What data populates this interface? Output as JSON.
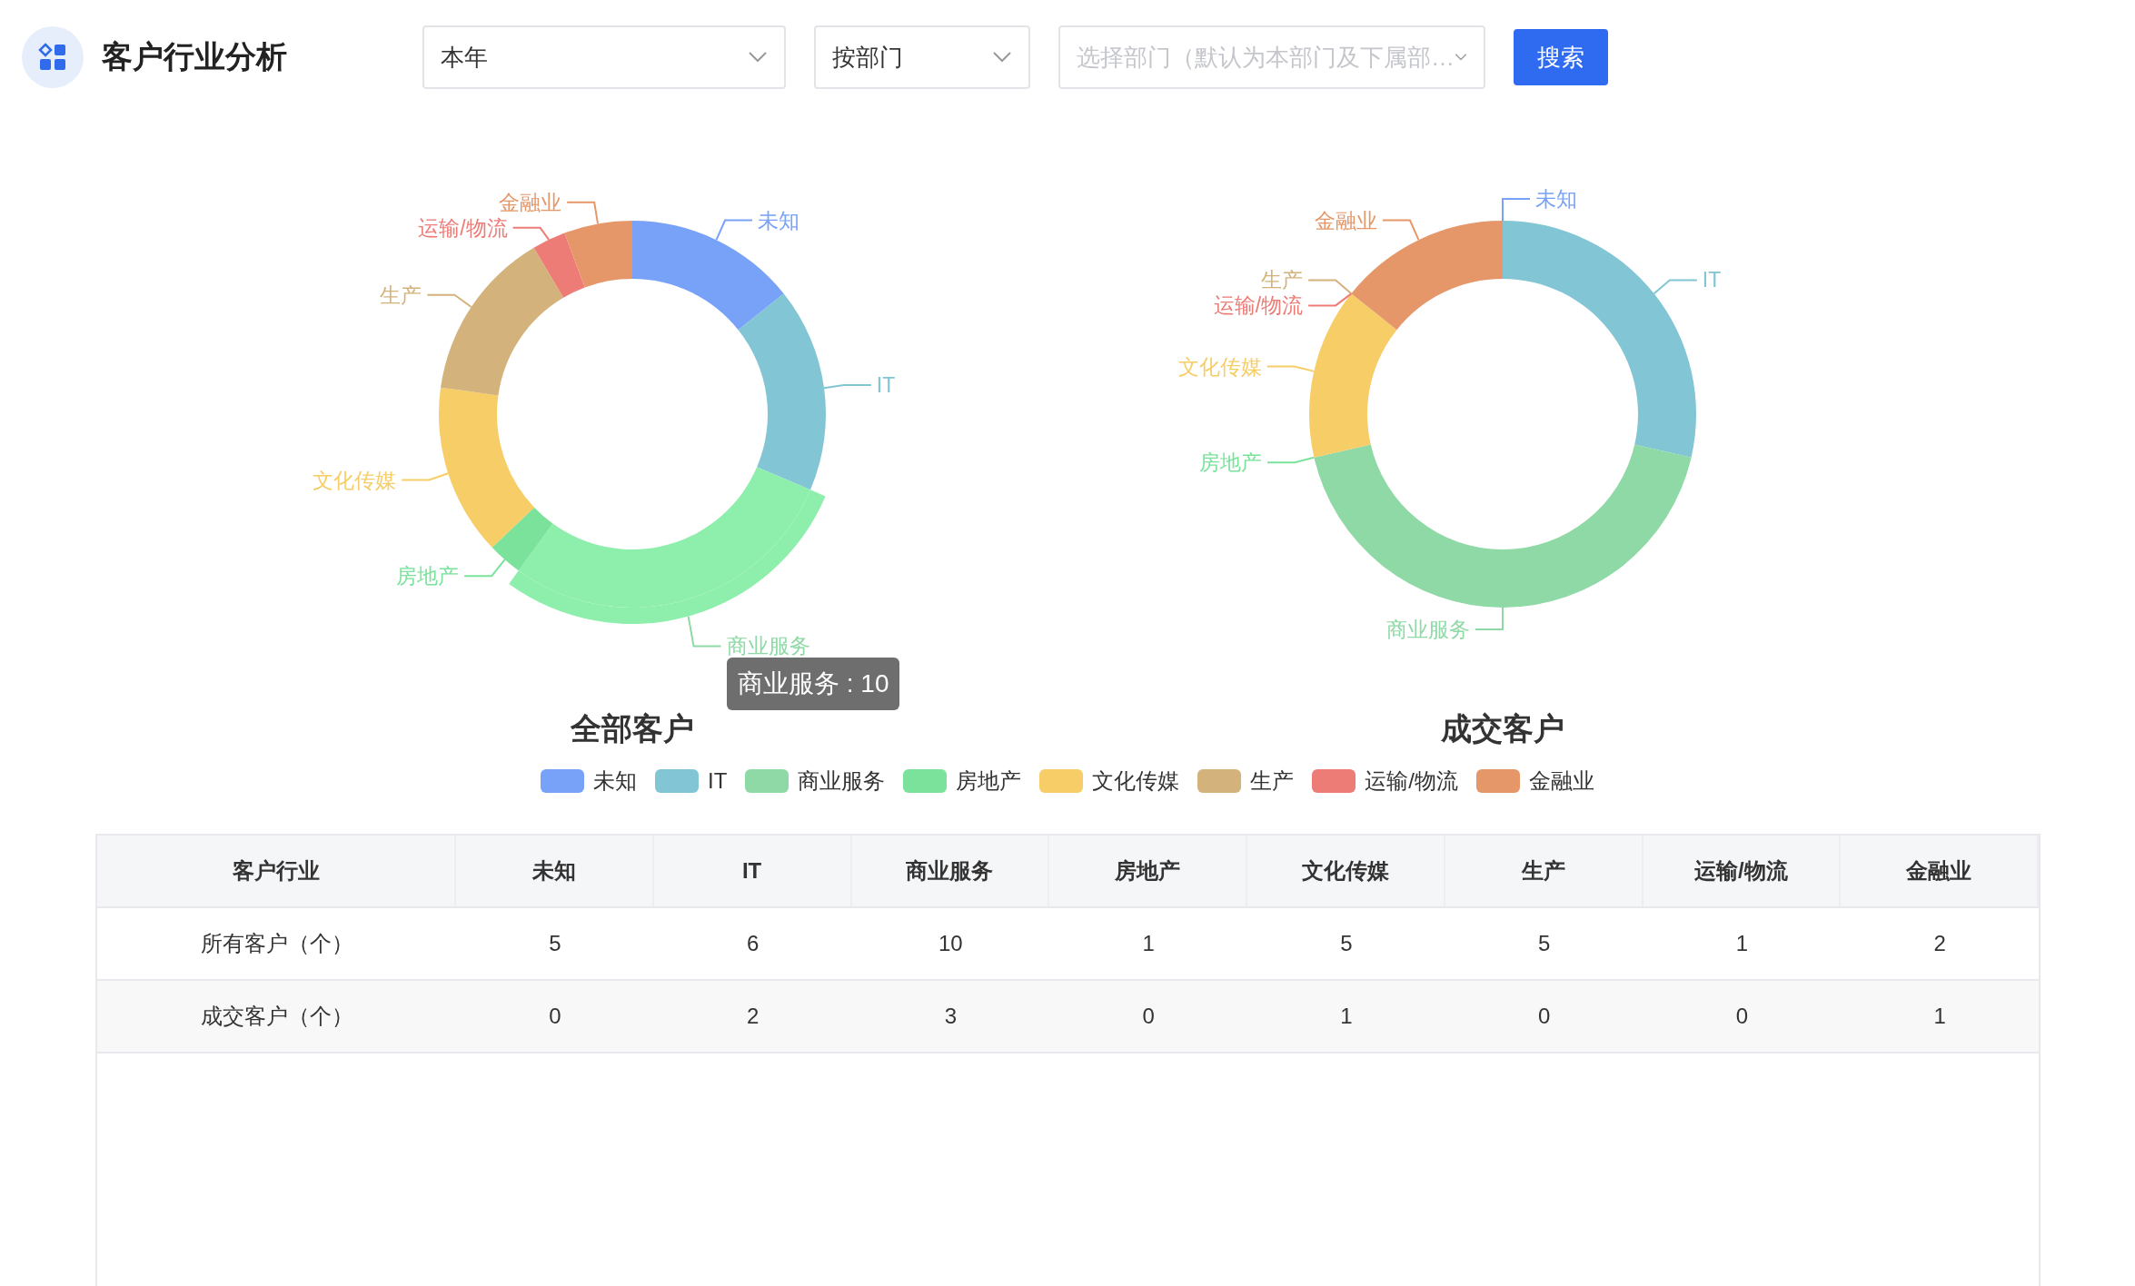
{
  "header": {
    "title": "客户行业分析"
  },
  "filters": [
    {
      "kind": "select",
      "value": "本年"
    },
    {
      "kind": "select",
      "value": "按部门"
    },
    {
      "kind": "select",
      "placeholder": "选择部门（默认为本部门及下属部…"
    }
  ],
  "search_button": {
    "label": "搜索"
  },
  "charts": [
    {
      "title": "全部客户",
      "tooltip": "商业服务 : 10",
      "emphasized": [
        false,
        false,
        true,
        false,
        false,
        false,
        false,
        false
      ],
      "chart_data": {
        "type": "donut",
        "categories": [
          "未知",
          "IT",
          "商业服务",
          "房地产",
          "文化传媒",
          "生产",
          "运输/物流",
          "金融业"
        ],
        "values": [
          14.3,
          17.1,
          28.6,
          2.9,
          14.3,
          14.3,
          2.8,
          5.7
        ]
      }
    },
    {
      "title": "成交客户",
      "chart_data": {
        "type": "donut",
        "categories": [
          "未知",
          "IT",
          "商业服务",
          "房地产",
          "文化传媒",
          "生产",
          "运输/物流",
          "金融业"
        ],
        "values": [
          0,
          28.6,
          42.8,
          0,
          14.3,
          0,
          0,
          14.3
        ]
      }
    }
  ],
  "legend": [
    {
      "label": "未知",
      "color": "#78a2f7"
    },
    {
      "label": "IT",
      "color": "#82c5d4"
    },
    {
      "label": "商业服务",
      "color": "#8ed9a5"
    },
    {
      "label": "房地产",
      "color": "#7ae29a"
    },
    {
      "label": "文化传媒",
      "color": "#f6cd66"
    },
    {
      "label": "生产",
      "color": "#d4b27c"
    },
    {
      "label": "运输/物流",
      "color": "#ed7c77"
    },
    {
      "label": "金融业",
      "color": "#e59769"
    }
  ],
  "table": {
    "columns": [
      "客户行业",
      "未知",
      "IT",
      "商业服务",
      "房地产",
      "文化传媒",
      "生产",
      "运输/物流",
      "金融业"
    ],
    "rows": [
      [
        "所有客户（个）",
        "5",
        "6",
        "10",
        "1",
        "5",
        "5",
        "1",
        "2"
      ],
      [
        "成交客户（个）",
        "0",
        "2",
        "3",
        "0",
        "1",
        "0",
        "0",
        "1"
      ]
    ]
  }
}
